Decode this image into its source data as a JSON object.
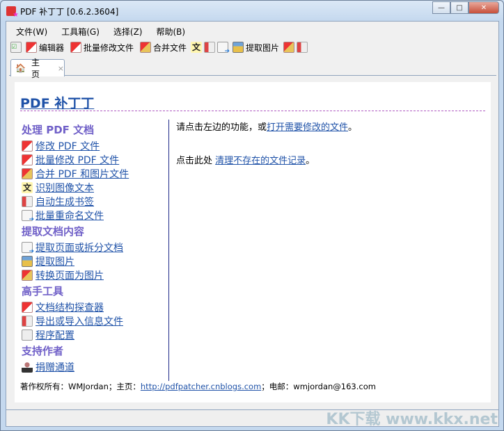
{
  "window": {
    "title": "PDF 补丁丁 [0.6.2.3604]",
    "minimize": "—",
    "maximize": "□",
    "close": "✕"
  },
  "menu": [
    "文件(W)",
    "工具箱(G)",
    "选择(Z)",
    "帮助(B)"
  ],
  "toolbar": {
    "editor": "编辑器",
    "batch_modify": "批量修改文件",
    "merge": "合并文件",
    "extract_images": "提取图片"
  },
  "tab": {
    "label": "主页",
    "close": "×"
  },
  "main": {
    "heading": "PDF 补丁丁",
    "sections": [
      {
        "title": "处理 PDF 文档",
        "items": [
          {
            "label": "修改 PDF 文件",
            "icon": "pdf"
          },
          {
            "label": "批量修改 PDF 文件",
            "icon": "pdf"
          },
          {
            "label": "合并 PDF 和图片文件",
            "icon": "merge"
          },
          {
            "label": "识别图像文本",
            "icon": "ocr"
          },
          {
            "label": "自动生成书签",
            "icon": "book"
          },
          {
            "label": "批量重命名文件",
            "icon": "page"
          }
        ]
      },
      {
        "title": "提取文档内容",
        "items": [
          {
            "label": "提取页面或拆分文档",
            "icon": "page"
          },
          {
            "label": "提取图片",
            "icon": "img"
          },
          {
            "label": "转换页面为图片",
            "icon": "merge"
          }
        ]
      },
      {
        "title": "高手工具",
        "items": [
          {
            "label": "文档结构探查器",
            "icon": "pdf"
          },
          {
            "label": "导出或导入信息文件",
            "icon": "book"
          },
          {
            "label": "程序配置",
            "icon": "chk"
          }
        ]
      },
      {
        "title": "支持作者",
        "items": [
          {
            "label": "捐赠通道",
            "icon": "user"
          }
        ]
      }
    ],
    "hint1_prefix": "请点击左边的功能，或",
    "hint1_link": "打开需要修改的文件",
    "hint1_suffix": "。",
    "hint2_prefix": "点击此处 ",
    "hint2_link": "清理不存在的文件记录",
    "hint2_suffix": "。",
    "footer_prefix": "著作权所有：WMJordan；主页：",
    "footer_link": "http://pdfpatcher.cnblogs.com",
    "footer_suffix": "；电邮：wmjordan@163.com"
  },
  "watermark": "KK下载 www.kkx.net"
}
